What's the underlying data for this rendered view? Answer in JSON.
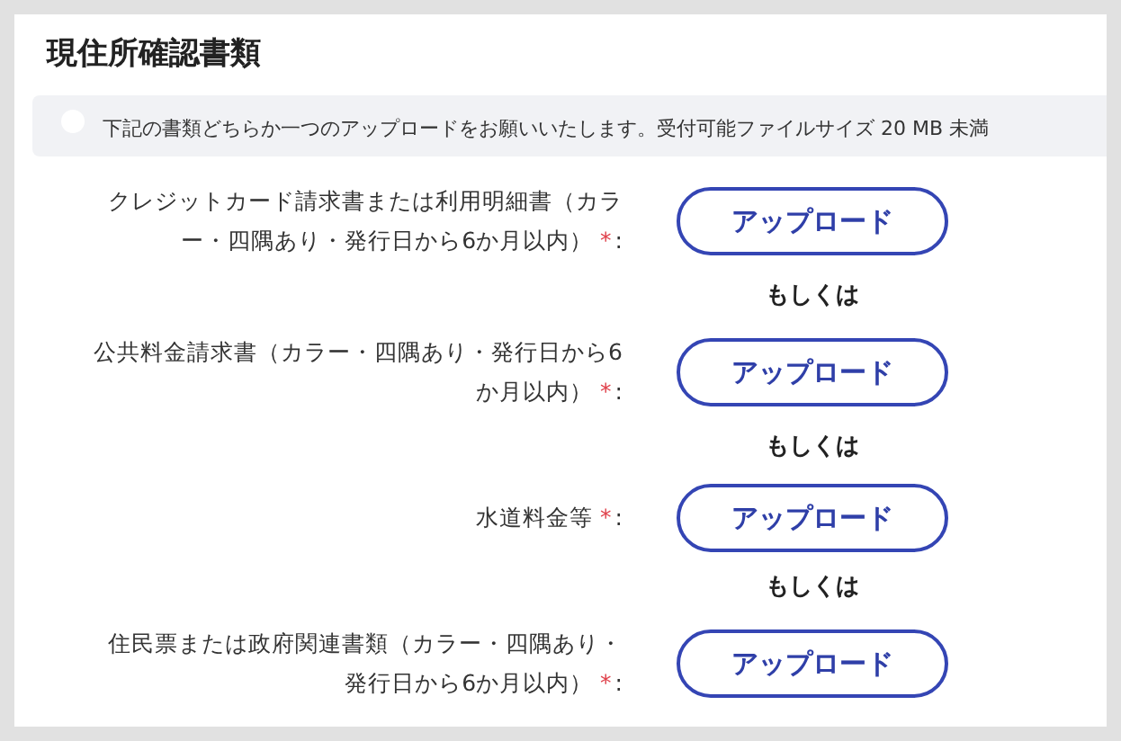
{
  "title": "現住所確認書類",
  "notice": {
    "text": "下記の書類どちらか一つのアップロードをお願いいたします。受付可能ファイルサイズ 20 MB 未満"
  },
  "documents": [
    {
      "label_lines": [
        "クレジットカード請求書または利用明細書（カラ",
        "ー・四隅あり・発行日から6か月以内）"
      ],
      "asterisk": "*",
      "colon": ":",
      "button": "アップロード",
      "separator": "もしくは"
    },
    {
      "label_lines": [
        "公共料金請求書（カラー・四隅あり・発行日から6",
        "か月以内）"
      ],
      "asterisk": "*",
      "colon": ":",
      "button": "アップロード",
      "separator": "もしくは"
    },
    {
      "label_lines": [
        "水道料金等"
      ],
      "asterisk": "*",
      "colon": ":",
      "button": "アップロード",
      "separator": "もしくは"
    },
    {
      "label_lines": [
        "住民票または政府関連書類（カラー・四隅あり・",
        "発行日から6か月以内）"
      ],
      "asterisk": "*",
      "colon": ":",
      "button": "アップロード"
    }
  ]
}
